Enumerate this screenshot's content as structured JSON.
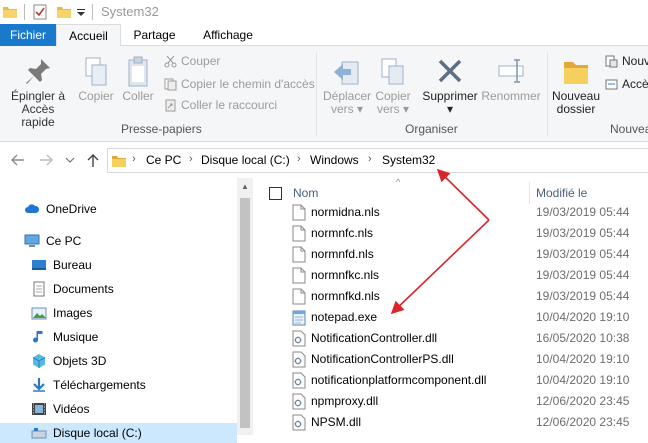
{
  "window": {
    "title": "System32"
  },
  "tabs": [
    {
      "label": "Fichier"
    },
    {
      "label": "Accueil"
    },
    {
      "label": "Partage"
    },
    {
      "label": "Affichage"
    }
  ],
  "ribbon": {
    "pin_label_line1": "Épingler à",
    "pin_label_line2": "Accès rapide",
    "copy_label": "Copier",
    "paste_label": "Coller",
    "cut_label": "Couper",
    "copy_path_label": "Copier le chemin d'accès",
    "paste_shortcut_label": "Coller le raccourci",
    "clipboard_group": "Presse-papiers",
    "move_line1": "Déplacer",
    "move_line2": "vers",
    "copyto_line1": "Copier",
    "copyto_line2": "vers",
    "delete_label": "Supprimer",
    "rename_label": "Renommer",
    "organize_group": "Organiser",
    "newfolder_line1": "Nouveau",
    "newfolder_line2": "dossier",
    "new_item_label": "Nouv",
    "easy_access_label": "Accè",
    "new_group": "Nouvea"
  },
  "address": {
    "crumbs": [
      "Ce PC",
      "Disque local (C:)",
      "Windows",
      "System32"
    ]
  },
  "navpane": {
    "items": [
      {
        "label": "OneDrive",
        "icon": "cloud-icon"
      },
      {
        "label": "Ce PC",
        "icon": "computer-icon"
      },
      {
        "label": "Bureau",
        "icon": "desktop-icon"
      },
      {
        "label": "Documents",
        "icon": "documents-icon"
      },
      {
        "label": "Images",
        "icon": "pictures-icon"
      },
      {
        "label": "Musique",
        "icon": "music-icon"
      },
      {
        "label": "Objets 3D",
        "icon": "cube-icon"
      },
      {
        "label": "Téléchargements",
        "icon": "download-icon"
      },
      {
        "label": "Vidéos",
        "icon": "video-icon"
      },
      {
        "label": "Disque local (C:)",
        "icon": "drive-icon"
      }
    ]
  },
  "filelist": {
    "col_name": "Nom",
    "col_modified": "Modifié le",
    "files": [
      {
        "name": "normidna.nls",
        "date": "19/03/2019 05:44",
        "icon": "file-icon"
      },
      {
        "name": "normnfc.nls",
        "date": "19/03/2019 05:44",
        "icon": "file-icon"
      },
      {
        "name": "normnfd.nls",
        "date": "19/03/2019 05:44",
        "icon": "file-icon"
      },
      {
        "name": "normnfkc.nls",
        "date": "19/03/2019 05:44",
        "icon": "file-icon"
      },
      {
        "name": "normnfkd.nls",
        "date": "19/03/2019 05:44",
        "icon": "file-icon"
      },
      {
        "name": "notepad.exe",
        "date": "10/04/2020 19:10",
        "icon": "notepad-icon"
      },
      {
        "name": "NotificationController.dll",
        "date": "16/05/2020 10:38",
        "icon": "dll-icon"
      },
      {
        "name": "NotificationControllerPS.dll",
        "date": "10/04/2020 19:10",
        "icon": "dll-icon"
      },
      {
        "name": "notificationplatformcomponent.dll",
        "date": "10/04/2020 19:10",
        "icon": "dll-icon"
      },
      {
        "name": "npmproxy.dll",
        "date": "12/06/2020 23:45",
        "icon": "dll-icon"
      },
      {
        "name": "NPSM.dll",
        "date": "12/06/2020 23:45",
        "icon": "dll-icon"
      }
    ]
  },
  "colors": {
    "accent": "#1979ca",
    "annotation": "#d9262a",
    "selection": "#cce8ff"
  }
}
